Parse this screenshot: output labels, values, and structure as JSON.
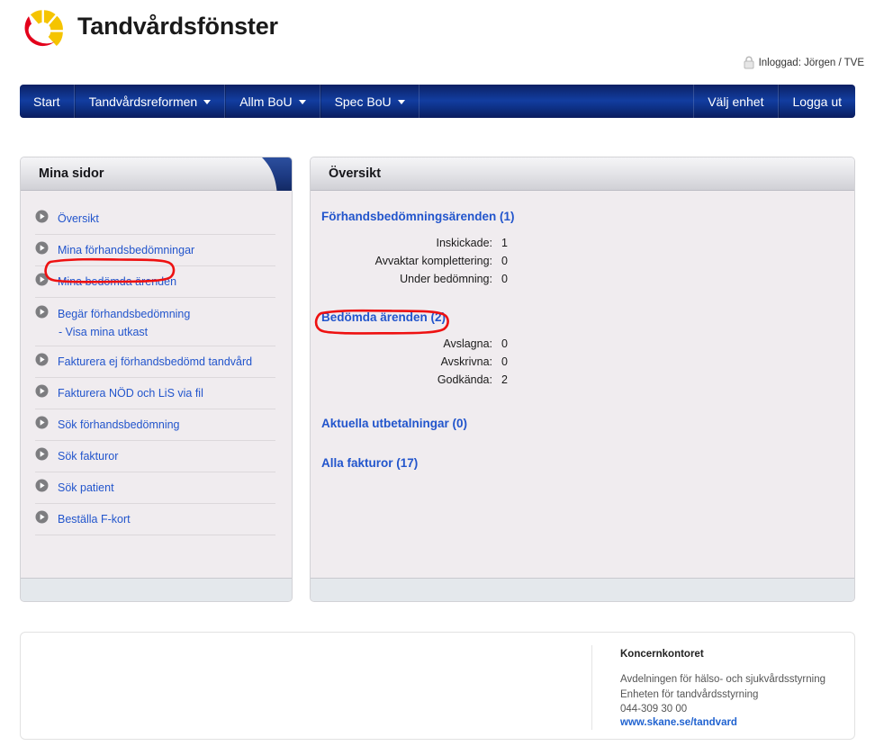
{
  "header": {
    "app_title": "Tandvårdsfönster",
    "logo_icon": "region-skane-logo",
    "logo_colors": {
      "yellow": "#f5c400",
      "red": "#e3001b"
    }
  },
  "login": {
    "icon": "lock-icon",
    "text": "Inloggad: Jörgen / TVE"
  },
  "nav": {
    "items": [
      {
        "label": "Start",
        "has_caret": false
      },
      {
        "label": "Tandvårdsreformen",
        "has_caret": true
      },
      {
        "label": "Allm BoU",
        "has_caret": true
      },
      {
        "label": "Spec BoU",
        "has_caret": true
      }
    ],
    "right_items": [
      {
        "label": "Välj enhet"
      },
      {
        "label": "Logga ut"
      }
    ],
    "accent_color": "#123da0"
  },
  "sidebar": {
    "title": "Mina sidor",
    "items": [
      {
        "label": "Översikt",
        "icon": "play-circle-icon"
      },
      {
        "label": "Mina förhandsbedömningar",
        "icon": "play-circle-icon"
      },
      {
        "label": "Mina bedömda ärenden",
        "icon": "play-circle-icon",
        "highlighted": true
      },
      {
        "label": "Begär förhandsbedömning",
        "icon": "play-circle-icon",
        "sub_label": "- Visa mina utkast"
      },
      {
        "label": "Fakturera ej förhandsbedömd tandvård",
        "icon": "play-circle-icon"
      },
      {
        "label": "Fakturera NÖD och LiS via fil",
        "icon": "play-circle-icon"
      },
      {
        "label": "Sök förhandsbedömning",
        "icon": "play-circle-icon"
      },
      {
        "label": "Sök fakturor",
        "icon": "play-circle-icon"
      },
      {
        "label": "Sök patient",
        "icon": "play-circle-icon"
      },
      {
        "label": "Beställa F-kort",
        "icon": "play-circle-icon"
      }
    ]
  },
  "main": {
    "title": "Översikt",
    "section_forhands": {
      "title": "Förhandsbedömningsärenden (1)",
      "rows": [
        {
          "label": "Inskickade:",
          "value": "1"
        },
        {
          "label": "Avvaktar komplettering:",
          "value": "0"
        },
        {
          "label": "Under bedömning:",
          "value": "0"
        }
      ]
    },
    "section_bedomda": {
      "title": "Bedömda ärenden (2)",
      "highlighted": true,
      "rows": [
        {
          "label": "Avslagna:",
          "value": "0"
        },
        {
          "label": "Avskrivna:",
          "value": "0"
        },
        {
          "label": "Godkända:",
          "value": "2"
        }
      ]
    },
    "link_utbetalningar": "Aktuella utbetalningar (0)",
    "link_fakturor": "Alla fakturor (17)"
  },
  "annotations": {
    "color": "#ee1111",
    "items": [
      {
        "target": "Mina bedömda ärenden",
        "shape": "hand-drawn-rounded-rect"
      },
      {
        "target": "Bedömda ärenden (2)",
        "shape": "hand-drawn-rounded-rect"
      }
    ]
  },
  "footer": {
    "org": "Koncernkontoret",
    "line1": "Avdelningen för hälso- och sjukvårdsstyrning",
    "line2": "Enheten för tandvårdsstyrning",
    "phone": "044-309 30 00",
    "url": "www.skane.se/tandvard"
  }
}
